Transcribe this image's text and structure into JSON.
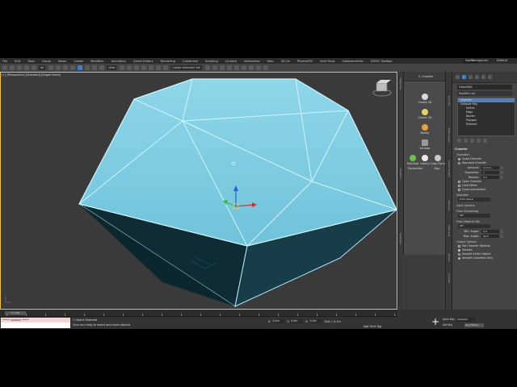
{
  "menubar": {
    "items": [
      "File",
      "Edit",
      "Tools",
      "Group",
      "Views",
      "Create",
      "Modifiers",
      "Animation",
      "Graph Editors",
      "Rendering",
      "Customize",
      "Scripting",
      "Content",
      "Interactive",
      "Help",
      "3D Ox",
      "PhoenixFD",
      "Inlex Tools",
      "SubstanceHub",
      "STATIC Toolbox"
    ],
    "signin": "Sign In",
    "workspace_label": "Workspaces:",
    "workspace_value": "Default"
  },
  "toolbar": {
    "filter": "All",
    "view": "View",
    "selection_set": "Create Selection Set"
  },
  "viewport": {
    "label": "[+] [Perspective] [Standard] [Edged Faces]",
    "gem_color": "#7dcde3",
    "shadow_color": "#123640",
    "border_color": "#f2c22c"
  },
  "ribbon_tabs": [
    "Modeling",
    "Freeform",
    "Selection"
  ],
  "midpanel": {
    "title": "5. Chamfer",
    "buttons": [
      "Create 3D",
      "Create 2D",
      "Modify",
      "Window",
      "Edit/Add",
      "Library",
      "Copy Form",
      "Transmitter",
      "Sign"
    ]
  },
  "right_strip": [
    "Last File",
    "MedicGroup",
    "Spline Project",
    "MaxCam",
    "Gate Tray",
    "Sphere",
    "Cylinder",
    "Lathe Tool",
    "Sweep Profile"
  ],
  "command_panel": {
    "object_name": "Object001",
    "modifier_list": "Modifier List",
    "stack": [
      {
        "label": "Chamfer",
        "selected": true,
        "sub": false
      },
      {
        "label": "Editable Poly",
        "selected": false,
        "sub": false
      },
      {
        "label": "Vertex",
        "selected": false,
        "sub": true
      },
      {
        "label": "Edge",
        "selected": false,
        "sub": true
      },
      {
        "label": "Border",
        "selected": false,
        "sub": true
      },
      {
        "label": "Polygon",
        "selected": false,
        "sub": true
      },
      {
        "label": "Element",
        "selected": false,
        "sub": true
      }
    ],
    "rollout_title": "Chamfer",
    "operation_label": "Operation",
    "quad_chamfer": "Quad Chamfer",
    "standard_chamfer": "Standard Chamfer",
    "amount_label": "Amount:",
    "amount_value": "0,0mm",
    "segments_label": "Segments:",
    "segments_value": "1",
    "tension_label": "Tension:",
    "tension_value": "0,5",
    "open_chamfer": "Open Chamfer",
    "limit_effect": "Limit Effect",
    "quad_intersection": "Quad Intersection",
    "selection_label": "Selection",
    "selection_value": "From Stack",
    "input_options": "Input Options",
    "from_smoothing": "From Smoothing",
    "smoothing_value": "Off",
    "from_material": "From Material IDs",
    "material_value": "Off",
    "min_angle_label": "Min. Angle:",
    "min_angle_value": "0,0",
    "max_angle_label": "Max. Angle:",
    "max_angle_value": "90,0",
    "output_options": "Output Options",
    "set_chamfer_material": "Set Chamfer Material",
    "smooth_label": "Smooth",
    "smooth_entire": "Smooth Entire Object",
    "smooth_chamfers": "Smooth Chamfers Only"
  },
  "bottom": {
    "frame_counter": "0 / 100",
    "script_text": "***** Updated *****",
    "status1": "1 Object Selected",
    "status2": "Click and drag to select and move objects",
    "x_label": "X:",
    "x_value": "0,0m",
    "y_label": "Y:",
    "y_value": "0,0m",
    "z_label": "Z:",
    "z_value": "0,0m",
    "grid_label": "Grid = 0,1m",
    "add_time_tag": "Add Time Tag",
    "auto_key": "Auto Key",
    "set_key": "Set Key",
    "key_selected": "Selected",
    "key_filters": "Key Filters..."
  }
}
